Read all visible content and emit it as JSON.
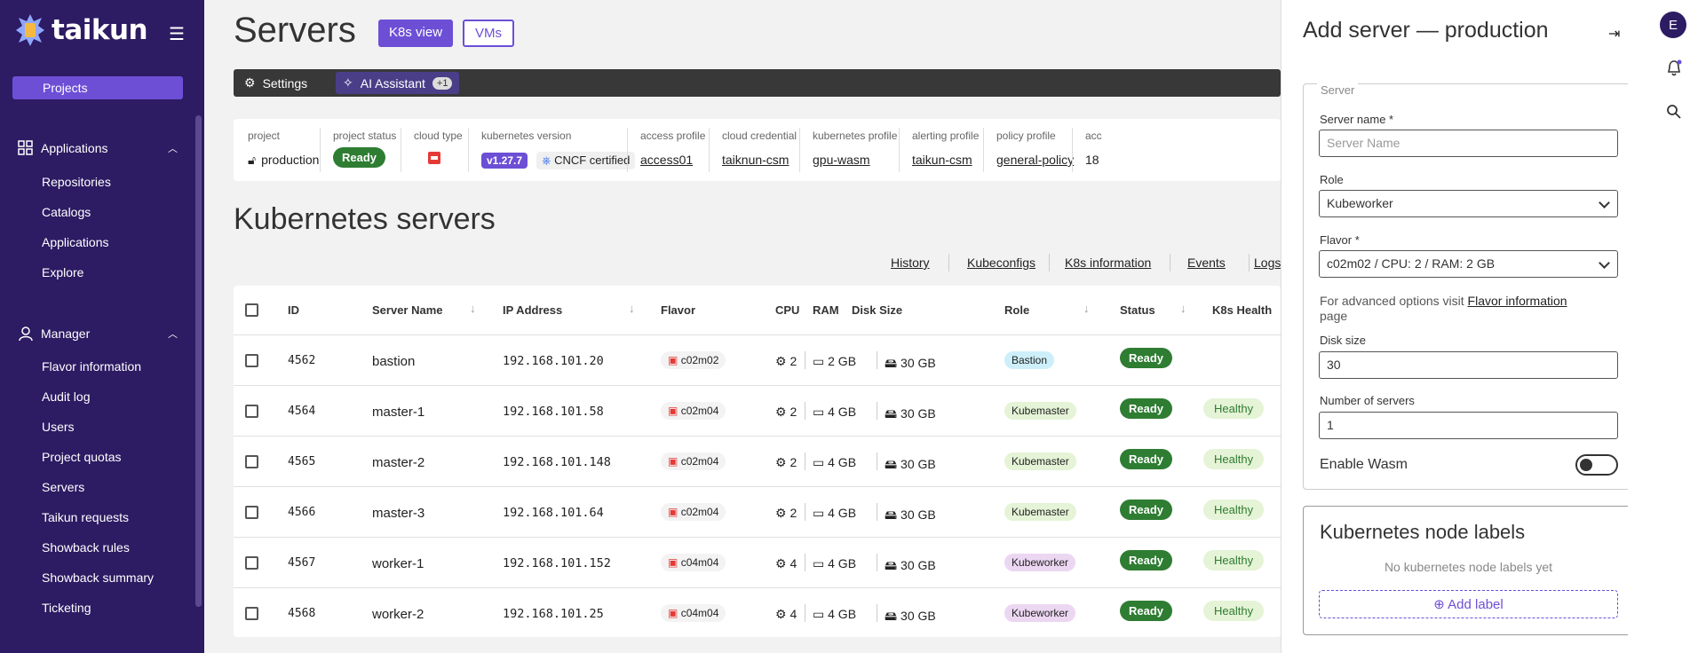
{
  "sidebar": {
    "logo": "taikun",
    "projects": "Projects",
    "applications_section": "Applications",
    "applications_items": [
      "Repositories",
      "Catalogs",
      "Applications",
      "Explore"
    ],
    "manager_section": "Manager",
    "manager_items": [
      "Flavor information",
      "Audit log",
      "Users",
      "Project quotas",
      "Servers",
      "Taikun requests",
      "Showback rules",
      "Showback summary",
      "Ticketing"
    ]
  },
  "header": {
    "title": "Servers",
    "k8s_view": "K8s view",
    "vms": "VMs"
  },
  "toolbar": {
    "settings": "Settings",
    "ai_assistant": "AI Assistant",
    "ai_badge": "+1"
  },
  "info": {
    "project_label": "project",
    "project_value": "production",
    "status_label": "project status",
    "status_value": "Ready",
    "cloud_label": "cloud type",
    "k8s_label": "kubernetes version",
    "k8s_value": "v1.27.7",
    "cncf": "CNCF certified",
    "access_label": "access profile",
    "access_value": "access01",
    "cred_label": "cloud credential",
    "cred_value": "taiknun-csm",
    "kprof_label": "kubernetes profile",
    "kprof_value": "gpu-wasm",
    "alert_label": "alerting profile",
    "alert_value": "taikun-csm",
    "policy_label": "policy profile",
    "policy_value": "general-policy",
    "trunc_label": "acc",
    "trunc_value": "18"
  },
  "section_title": "Kubernetes servers",
  "links": [
    "History",
    "Kubeconfigs",
    "K8s information",
    "Events",
    "Logs"
  ],
  "table": {
    "headers": {
      "id": "ID",
      "name": "Server Name",
      "ip": "IP Address",
      "flavor": "Flavor",
      "cpu": "CPU",
      "ram": "RAM",
      "disk": "Disk Size",
      "role": "Role",
      "status": "Status",
      "health": "K8s Health"
    },
    "rows": [
      {
        "id": "4562",
        "name": "bastion",
        "ip": "192.168.101.20",
        "flavor": "c02m02",
        "cpu": "2",
        "ram": "2 GB",
        "disk": "30 GB",
        "role": "Bastion",
        "status": "Ready",
        "health": ""
      },
      {
        "id": "4564",
        "name": "master-1",
        "ip": "192.168.101.58",
        "flavor": "c02m04",
        "cpu": "2",
        "ram": "4 GB",
        "disk": "30 GB",
        "role": "Kubemaster",
        "status": "Ready",
        "health": "Healthy"
      },
      {
        "id": "4565",
        "name": "master-2",
        "ip": "192.168.101.148",
        "flavor": "c02m04",
        "cpu": "2",
        "ram": "4 GB",
        "disk": "30 GB",
        "role": "Kubemaster",
        "status": "Ready",
        "health": "Healthy"
      },
      {
        "id": "4566",
        "name": "master-3",
        "ip": "192.168.101.64",
        "flavor": "c02m04",
        "cpu": "2",
        "ram": "4 GB",
        "disk": "30 GB",
        "role": "Kubemaster",
        "status": "Ready",
        "health": "Healthy"
      },
      {
        "id": "4567",
        "name": "worker-1",
        "ip": "192.168.101.152",
        "flavor": "c04m04",
        "cpu": "4",
        "ram": "4 GB",
        "disk": "30 GB",
        "role": "Kubeworker",
        "status": "Ready",
        "health": "Healthy"
      },
      {
        "id": "4568",
        "name": "worker-2",
        "ip": "192.168.101.25",
        "flavor": "c04m04",
        "cpu": "4",
        "ram": "4 GB",
        "disk": "30 GB",
        "role": "Kubeworker",
        "status": "Ready",
        "health": "Healthy"
      }
    ]
  },
  "panel": {
    "title": "Add server — production",
    "fieldset": "Server",
    "name_label": "Server name *",
    "name_placeholder": "Server Name",
    "role_label": "Role",
    "role_value": "Kubeworker",
    "flavor_label": "Flavor *",
    "flavor_value": "c02m02 / CPU: 2 / RAM: 2 GB",
    "adv_text": "For advanced options visit",
    "adv_link": "Flavor information",
    "adv_tail": "page",
    "disk_label": "Disk size",
    "disk_value": "30",
    "count_label": "Number of servers",
    "count_value": "1",
    "wasm_label": "Enable Wasm",
    "labels_title": "Kubernetes node labels",
    "labels_empty": "No kubernetes node labels yet",
    "add_label": "Add label"
  },
  "rail": {
    "avatar": "E"
  },
  "colors": {
    "sidebar": "#2d1b63",
    "accent": "#6d4fd6",
    "ready": "#2e7d32"
  }
}
